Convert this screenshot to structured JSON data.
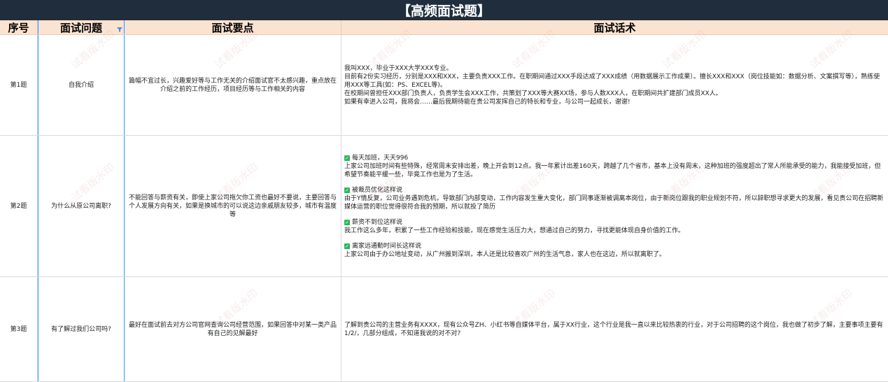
{
  "title": "【高频面试题】",
  "headers": {
    "no": "序号",
    "question": "面试问题",
    "points": "面试要点",
    "script": "面试话术"
  },
  "rows": [
    {
      "no": "第1题",
      "question": "自我介绍",
      "points": "篇幅不宜过长，兴趣爱好等与工作无关的介绍面试官不太感兴趣，重点放在介绍之前的工作经历，项目经历等与工作相关的内容",
      "lines": [
        "我叫XXX，毕业于XXX大学XXX专业。",
        "目前有2份实习经历，分别是XXX和XXX，主要负责XXX工作。在职期间通过XXX手段达成了XXX成绩（用数据展示工作成果）。擅长XXX和XXX（岗位技能如：数据分析、文案撰写等），熟练使用XXX等工具(如：PS、EXCEL等)。",
        "在校期间曾担任XXX部门负责人，负责学生会XXX工作，共策划了XXX等大赛XX场，参与人数XXX人，在职期间共扩建部门成员XX人。",
        "如果有幸进入公司，我将会……最后我期待能在贵公司发挥自己的特长和专业，与公司一起成长，谢谢!"
      ]
    },
    {
      "no": "第2题",
      "question": "为什么从原公司离职?",
      "points": "不能回答与薪资有关，即使上家公司拖欠你工资也最好不要说，主要回答与个人发展方向有关，如果是换城市的可以说这边亲戚朋友较多，城市有温度等",
      "items": [
        {
          "head": "每天加班，天天996",
          "body": "上家公司加班时间有些特殊，经常周末安排出差，晚上开会到12点。我一年累计出差160天，跨越了几个省市，基本上没有周末，这种加班的强度超出了常人所能承受的能力，我能接受加班，但希望节奏能平缓一些，毕竟工作也是为了生活。"
        },
        {
          "head": "被裁员优化这样说",
          "body": "由于Y情反复，公司业务遇到危机，导致部门内部变动，工作内容发生重大变化，部门同事逐渐被调离本岗位，由于新岗位跟我的职业规划不符，所以辞职想寻求更大的发展，看见贵公司在招聘新媒体运营的职位觉得很符合我的预期，所以就投了简历"
        },
        {
          "head": "薪资不到位这样说",
          "body": "我工作这么多年，积累了一些工作经验和技能，现在感觉生活压力大，想通过自己的努力，寻找更能体现自身价值的工作。"
        },
        {
          "head": "离家远通勤时间长这样说",
          "body": "上家公司由于办公地址变动，从广州搬到深圳，本人还是比较喜欢广州的生活气息，家人也在这边，所以就离职了。"
        }
      ]
    },
    {
      "no": "第3题",
      "question": "有了解过我们公司吗?",
      "points": "最好在面试前去对方公司官网查询公司经营范围，如果回答中对某一类产品有自己的见解最好",
      "lines": [
        "了解到贵公司的主营业务有XXXX，现有公众号ZH、小红书等自媒体平台，属于XX行业，这个行业是我一直以来比较热衷的行业，对于公司招聘的这个岗位，我也做了初步了解，主要事项主要有1/2/，几部分组成，不知道我说的对不对?"
      ]
    }
  ],
  "watermark": "试看版水印",
  "colors": {
    "title_bg": "#1f2d3d",
    "header_bg": "#fbe3d2",
    "check": "#2db55d",
    "selection": "#4a8fe8"
  }
}
